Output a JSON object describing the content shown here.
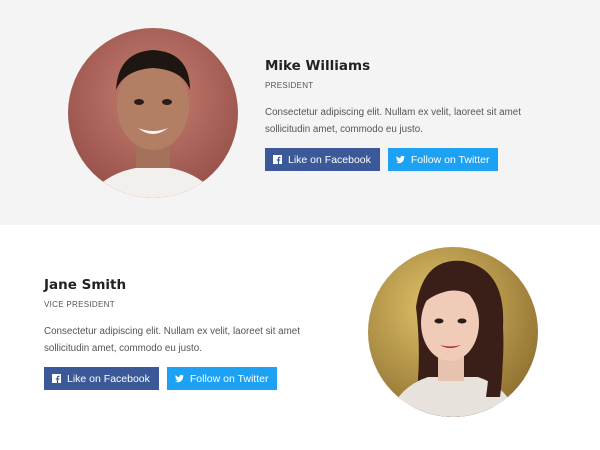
{
  "members": [
    {
      "name": "Mike Williams",
      "role": "PRESIDENT",
      "bio": "Consectetur adipiscing elit. Nullam ex velit, laoreet sit amet sollicitudin amet, commodo eu justo.",
      "facebook_label": "Like on Facebook",
      "twitter_label": "Follow on Twitter"
    },
    {
      "name": "Jane Smith",
      "role": "VICE PRESIDENT",
      "bio": "Consectetur adipiscing elit. Nullam ex velit, laoreet sit amet sollicitudin amet, commodo eu justo.",
      "facebook_label": "Like on Facebook",
      "twitter_label": "Follow on Twitter"
    }
  ],
  "icons": {
    "facebook": "facebook-icon",
    "twitter": "twitter-icon"
  },
  "colors": {
    "facebook": "#3b5998",
    "twitter": "#1da1f2",
    "section_gray": "#f4f4f4"
  }
}
